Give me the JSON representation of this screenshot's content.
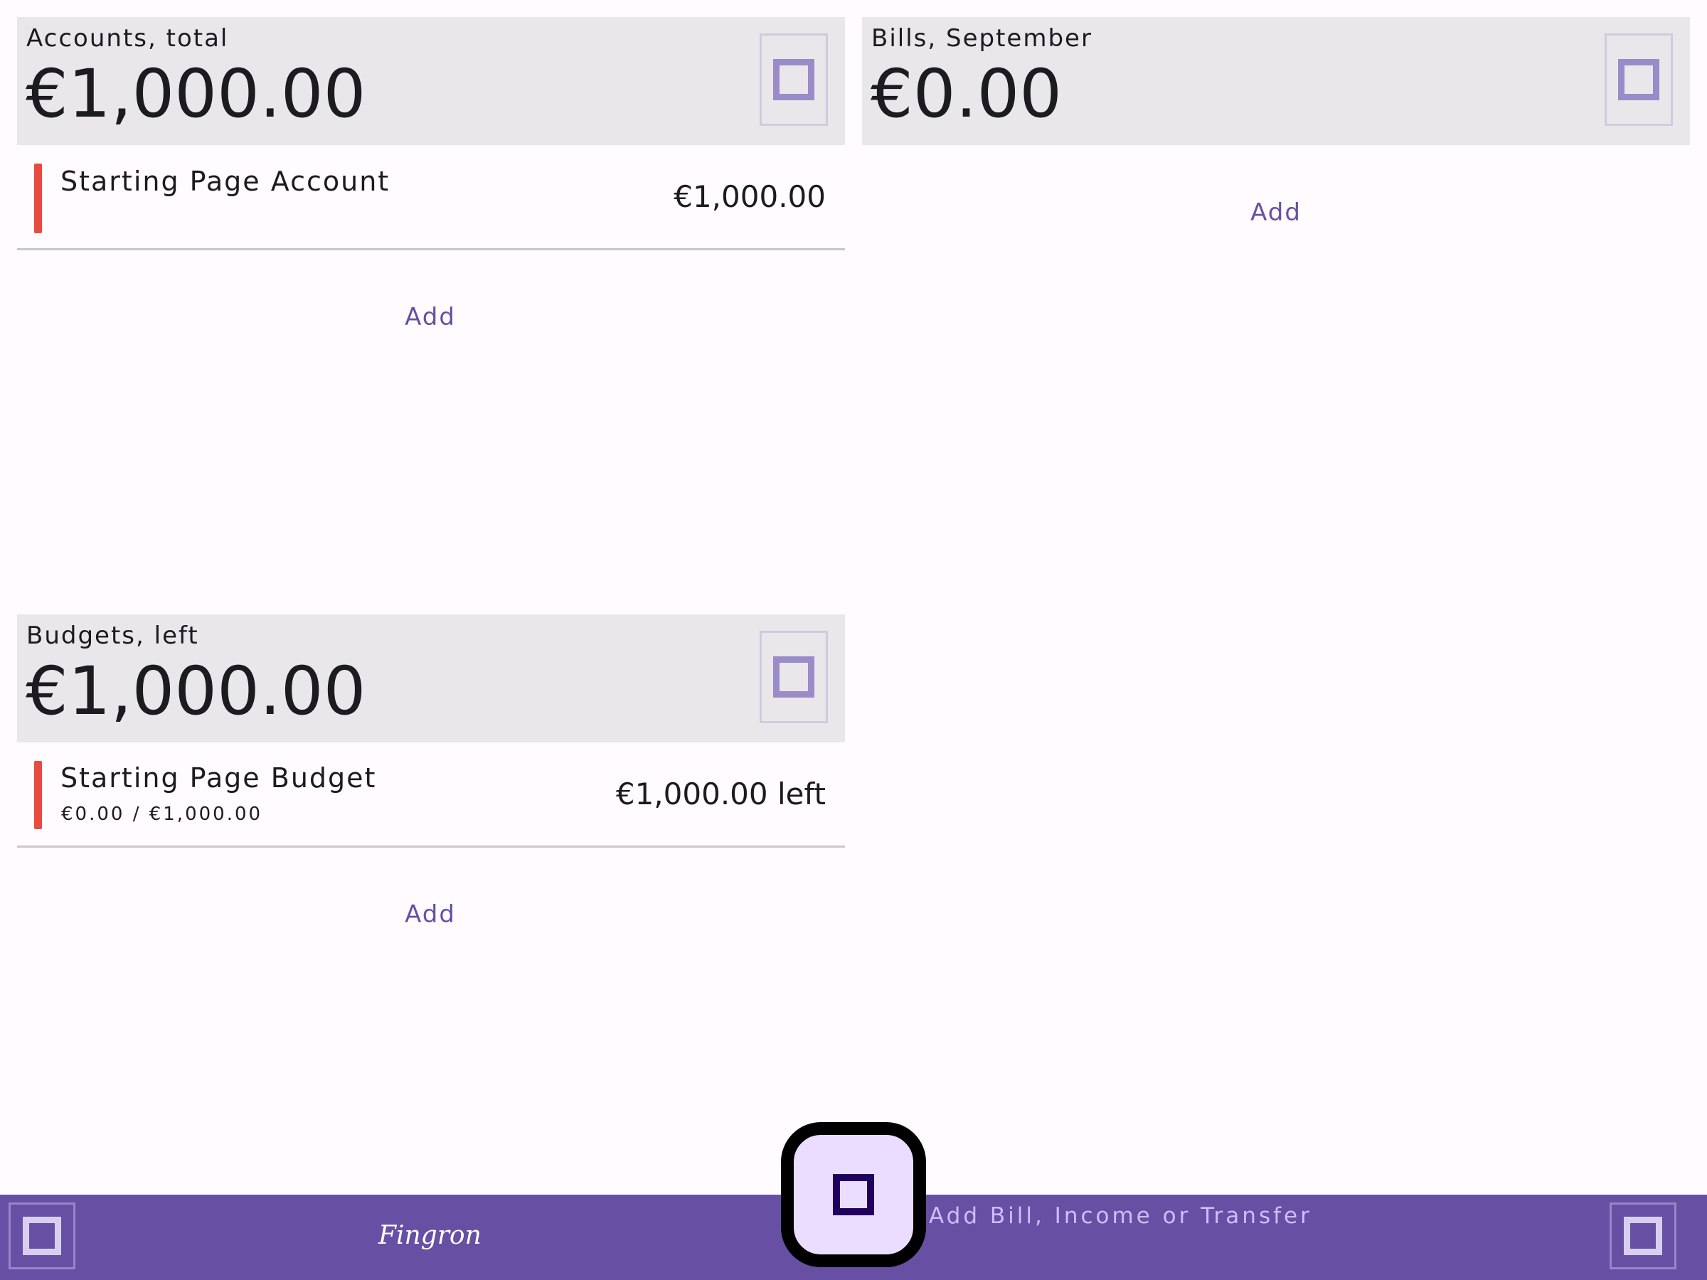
{
  "accounts": {
    "label": "Accounts, total",
    "total": "€1,000.00",
    "items": [
      {
        "name": "Starting Page Account",
        "value": "€1,000.00",
        "color": "#e94a3f"
      }
    ],
    "add_label": "Add",
    "header_icon": "square-icon"
  },
  "bills": {
    "label": "Bills, September",
    "total": "€0.00",
    "add_label": "Add",
    "header_icon": "square-icon"
  },
  "budgets": {
    "label": "Budgets, left",
    "total": "€1,000.00",
    "items": [
      {
        "name": "Starting Page Budget",
        "progress": "€0.00 / €1,000.00",
        "value": "€1,000.00 left",
        "color": "#e94a3f"
      }
    ],
    "add_label": "Add",
    "header_icon": "square-icon"
  },
  "bottom_bar": {
    "logo": "Fingron",
    "fab_label": "Add Bill, Income or Transfer",
    "left_icon": "square-icon",
    "right_icon": "square-icon",
    "fab_icon": "square-icon",
    "color": "#6750a4"
  }
}
